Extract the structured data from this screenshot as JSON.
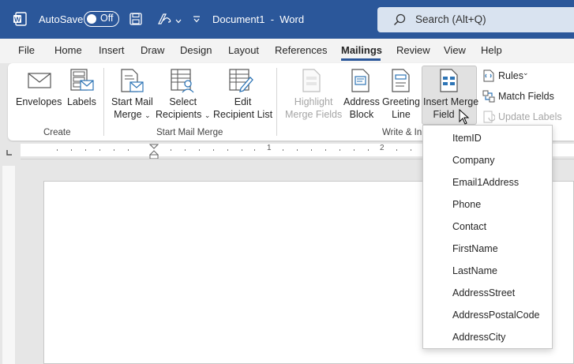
{
  "titlebar": {
    "autosave_label": "AutoSave",
    "autosave_state": "Off",
    "document_title": "Document1  -  Word",
    "search_placeholder": "Search (Alt+Q)"
  },
  "tabs": [
    {
      "label": "File"
    },
    {
      "label": "Home"
    },
    {
      "label": "Insert"
    },
    {
      "label": "Draw"
    },
    {
      "label": "Design"
    },
    {
      "label": "Layout"
    },
    {
      "label": "References"
    },
    {
      "label": "Mailings"
    },
    {
      "label": "Review"
    },
    {
      "label": "View"
    },
    {
      "label": "Help"
    }
  ],
  "ribbon": {
    "create": {
      "envelopes": "Envelopes",
      "labels": "Labels",
      "group": "Create"
    },
    "start_mail_merge": {
      "start_line1": "Start Mail",
      "start_line2": "Merge",
      "select_line1": "Select",
      "select_line2": "Recipients",
      "edit_line1": "Edit",
      "edit_line2": "Recipient List",
      "group": "Start Mail Merge"
    },
    "write_insert": {
      "highlight_line1": "Highlight",
      "highlight_line2": "Merge Fields",
      "address_line1": "Address",
      "address_line2": "Block",
      "greeting_line1": "Greeting",
      "greeting_line2": "Line",
      "insert_line1": "Insert Merge",
      "insert_line2": "Field",
      "rules": "Rules",
      "match_fields": "Match Fields",
      "update_labels": "Update Labels",
      "group": "Write & In"
    }
  },
  "ruler": {
    "marks": [
      "1",
      "2"
    ]
  },
  "merge_fields": [
    "ItemID",
    "Company",
    "Email1Address",
    "Phone",
    "Contact",
    "FirstName",
    "LastName",
    "AddressStreet",
    "AddressPostalCode",
    "AddressCity"
  ],
  "colors": {
    "title_bar": "#2b579a",
    "accent": "#2b579a"
  }
}
